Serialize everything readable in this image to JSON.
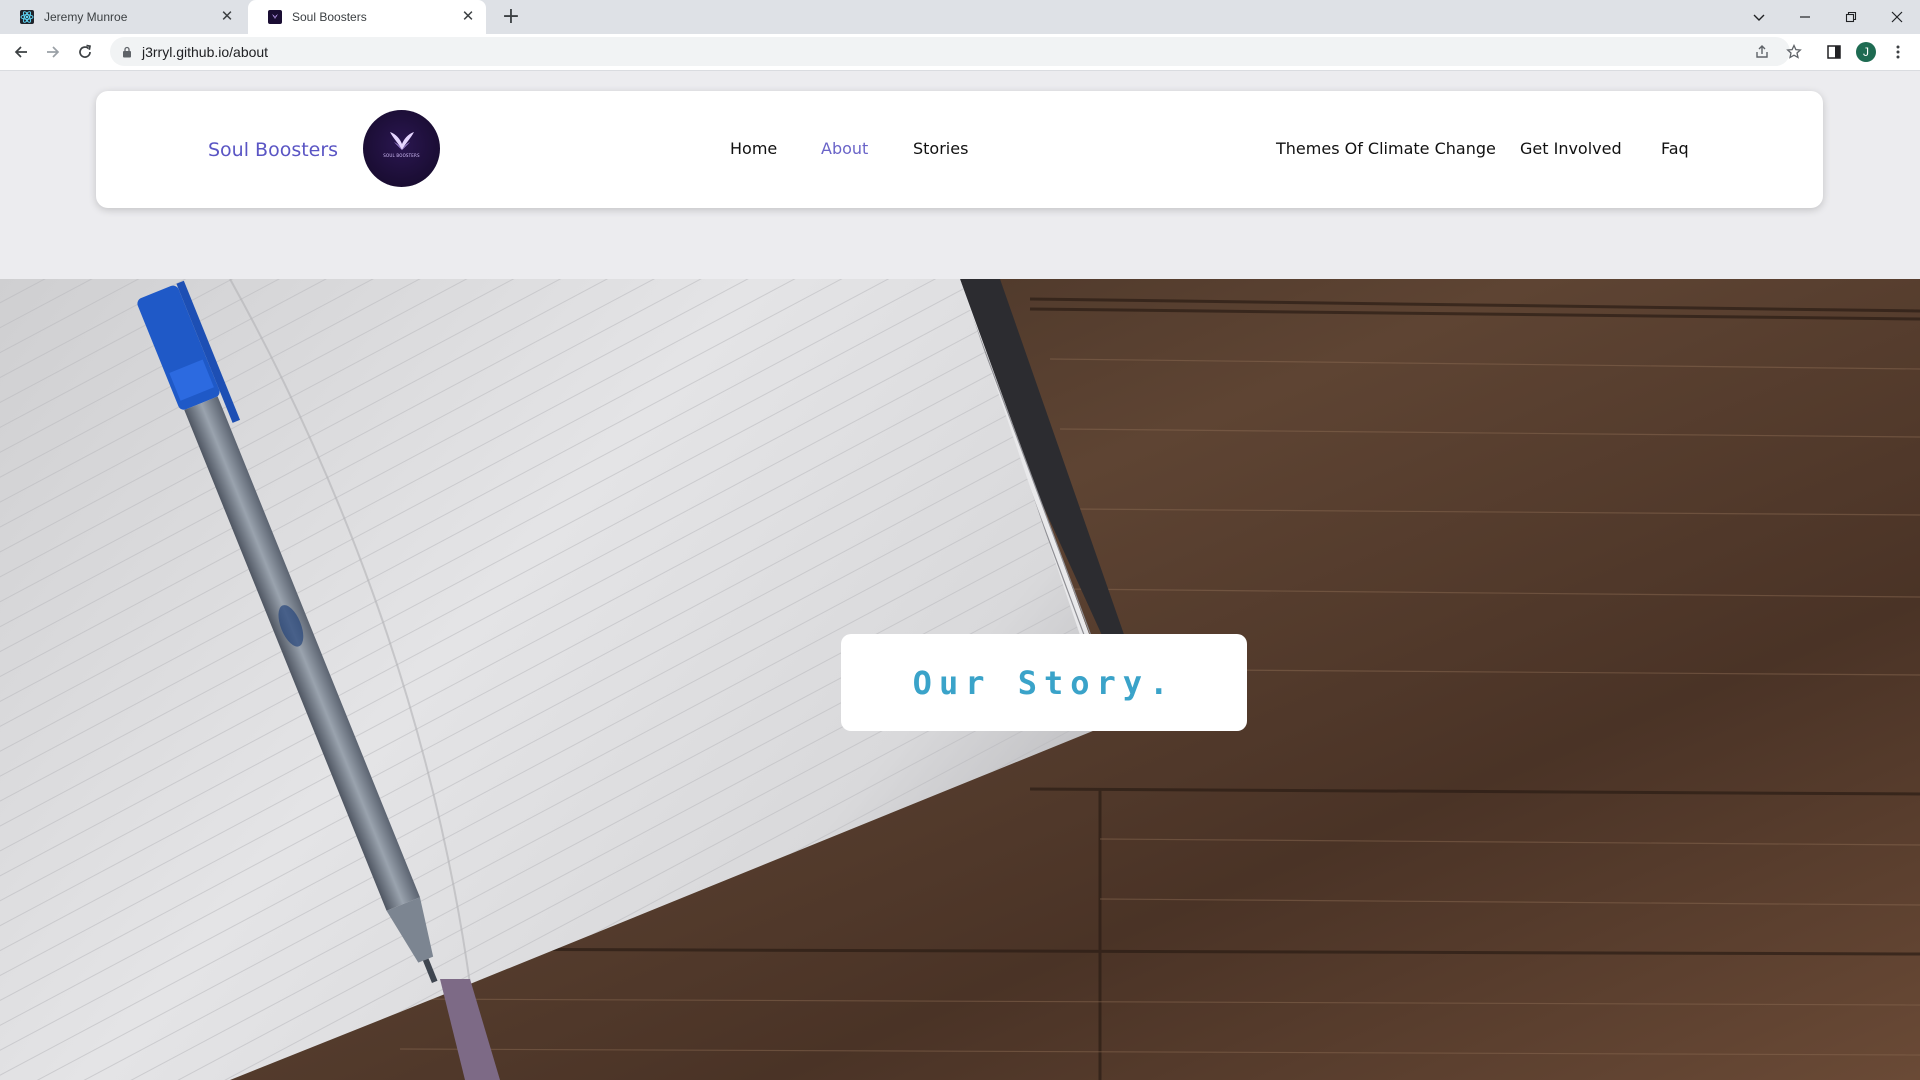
{
  "browser": {
    "tabs": [
      {
        "title": "Jeremy Munroe",
        "active": false
      },
      {
        "title": "Soul Boosters",
        "active": true
      }
    ],
    "url": "j3rryl.github.io/about",
    "profile_initial": "J"
  },
  "site": {
    "brand_name": "Soul Boosters",
    "logo_text": "SOUL BOOSTERS",
    "nav_left": [
      "Home",
      "About",
      "Stories"
    ],
    "nav_right": [
      "Themes Of Climate Change",
      "Get Involved",
      "Faq"
    ],
    "active_nav": "About"
  },
  "hero": {
    "heading": "Our Story."
  },
  "colors": {
    "brand": "#5a55c4",
    "active_link": "#6a64c8",
    "heading": "#3aa3c9",
    "logo_bg": "#1a0d33"
  }
}
